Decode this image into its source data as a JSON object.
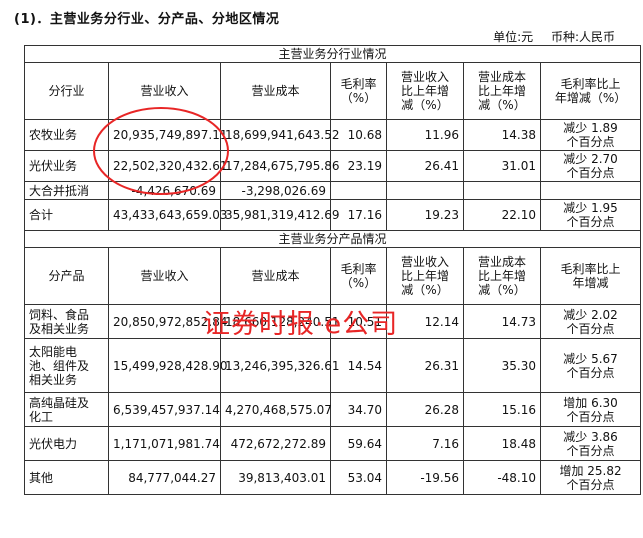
{
  "heading": "(1)．主营业务分行业、分产品、分地区情况",
  "unit": {
    "unit_label": "单位:元",
    "currency_label": "币种:人民币"
  },
  "industry": {
    "section_title": "主营业务分行业情况",
    "headers": [
      "分行业",
      "营业收入",
      "营业成本",
      "毛利率\n（%）",
      "营业收入\n比上年增\n减（%）",
      "营业成本\n比上年增\n减（%）",
      "毛利率比上\n年增减（%）"
    ],
    "rows": [
      {
        "name": "农牧业务",
        "revenue": "20,935,749,897.11",
        "cost": "18,699,941,643.52",
        "margin": "10.68",
        "rev_chg": "11.96",
        "cost_chg": "14.38",
        "margin_chg": "减少 1.89\n个百分点"
      },
      {
        "name": "光伏业务",
        "revenue": "22,502,320,432.61",
        "cost": "17,284,675,795.86",
        "margin": "23.19",
        "rev_chg": "26.41",
        "cost_chg": "31.01",
        "margin_chg": "减少 2.70\n个百分点"
      },
      {
        "name": "大合并抵消",
        "revenue": "-4,426,670.69",
        "cost": "-3,298,026.69",
        "margin": "",
        "rev_chg": "",
        "cost_chg": "",
        "margin_chg": ""
      },
      {
        "name": "合计",
        "revenue": "43,433,643,659.03",
        "cost": "35,981,319,412.69",
        "margin": "17.16",
        "rev_chg": "19.23",
        "cost_chg": "22.10",
        "margin_chg": "减少 1.95\n个百分点"
      }
    ]
  },
  "product": {
    "section_title": "主营业务分产品情况",
    "headers": [
      "分产品",
      "营业收入",
      "营业成本",
      "毛利率\n（%）",
      "营业收入\n比上年增\n减（%）",
      "营业成本\n比上年增\n减（%）",
      "毛利率比上\n年增减"
    ],
    "rows": [
      {
        "name": "饲料、食品\n及相关业务",
        "revenue": "20,850,972,852.84",
        "cost": "18,660,128,240.51",
        "margin": "10.51",
        "rev_chg": "12.14",
        "cost_chg": "14.73",
        "margin_chg": "减少 2.02\n个百分点"
      },
      {
        "name": "太阳能电\n池、组件及\n相关业务",
        "revenue": "15,499,928,428.90",
        "cost": "13,246,395,326.61",
        "margin": "14.54",
        "rev_chg": "26.31",
        "cost_chg": "35.30",
        "margin_chg": "减少 5.67\n个百分点"
      },
      {
        "name": "高纯晶硅及\n化工",
        "revenue": "6,539,457,937.14",
        "cost": "4,270,468,575.07",
        "margin": "34.70",
        "rev_chg": "26.28",
        "cost_chg": "15.16",
        "margin_chg": "增加 6.30\n个百分点"
      },
      {
        "name": "光伏电力",
        "revenue": "1,171,071,981.74",
        "cost": "472,672,272.89",
        "margin": "59.64",
        "rev_chg": "7.16",
        "cost_chg": "18.48",
        "margin_chg": "减少 3.86\n个百分点"
      },
      {
        "name": "其他",
        "revenue": "84,777,044.27",
        "cost": "39,813,403.01",
        "margin": "53.04",
        "rev_chg": "-19.56",
        "cost_chg": "-48.10",
        "margin_chg": "增加 25.82\n个百分点"
      }
    ]
  },
  "watermark": "证券时报·e公司",
  "colors": {
    "annotation": "#e82626",
    "border": "#333333"
  }
}
